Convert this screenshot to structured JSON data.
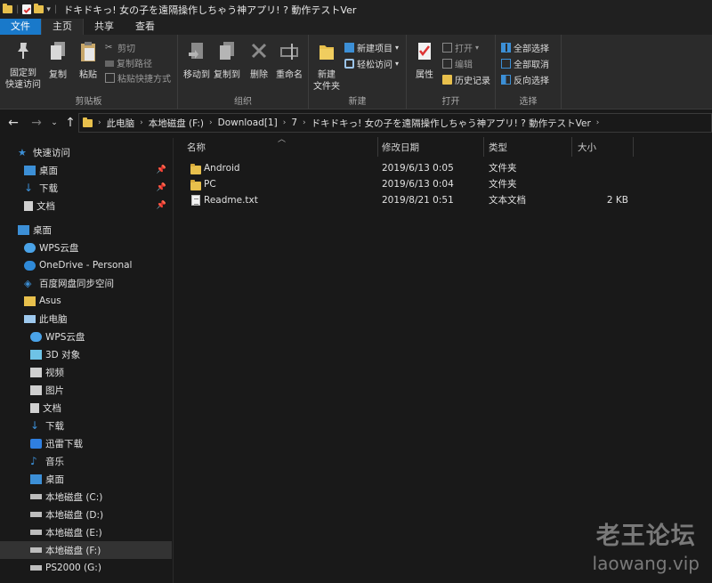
{
  "window": {
    "title": "ドキドキっ! 女の子を遠隔操作しちゃう神アプリ! ? 動作テストVer"
  },
  "ribbon_tabs": [
    "文件",
    "主页",
    "共享",
    "查看"
  ],
  "ribbon": {
    "clipboard": {
      "pin_label": "固定到\n快速访问",
      "copy": "复制",
      "paste": "粘贴",
      "cut": "剪切",
      "copy_path": "复制路径",
      "paste_shortcut": "粘贴快捷方式",
      "group": "剪贴板"
    },
    "organize": {
      "move_to": "移动到",
      "copy_to": "复制到",
      "delete": "删除",
      "rename": "重命名",
      "group": "组织"
    },
    "new": {
      "new_folder": "新建\n文件夹",
      "new_item": "新建项目",
      "easy_access": "轻松访问",
      "group": "新建"
    },
    "open": {
      "properties": "属性",
      "open": "打开",
      "edit": "编辑",
      "history": "历史记录",
      "group": "打开"
    },
    "select": {
      "select_all": "全部选择",
      "select_none": "全部取消",
      "invert": "反向选择",
      "group": "选择"
    }
  },
  "breadcrumb": [
    "此电脑",
    "本地磁盘 (F:)",
    "Download[1]",
    "7",
    "ドキドキっ! 女の子を遠隔操作しちゃう神アプリ! ? 動作テストVer"
  ],
  "nav": {
    "quick_access": "快速访问",
    "quick_items": [
      "桌面",
      "下载",
      "文档"
    ],
    "desktop": "桌面",
    "desktop_items": [
      "WPS云盘",
      "OneDrive - Personal",
      "百度网盘同步空间",
      "Asus",
      "此电脑"
    ],
    "pc_items": [
      "WPS云盘",
      "3D 对象",
      "视频",
      "图片",
      "文档",
      "下载",
      "迅雷下载",
      "音乐",
      "桌面",
      "本地磁盘 (C:)",
      "本地磁盘 (D:)",
      "本地磁盘 (E:)",
      "本地磁盘 (F:)",
      "PS2000 (G:)"
    ]
  },
  "columns": {
    "name": "名称",
    "modified": "修改日期",
    "type": "类型",
    "size": "大小"
  },
  "files": [
    {
      "name": "Android",
      "modified": "2019/6/13 0:05",
      "type": "文件夹",
      "size": "",
      "icon": "folder-icon"
    },
    {
      "name": "PC",
      "modified": "2019/6/13 0:04",
      "type": "文件夹",
      "size": "",
      "icon": "folder-icon"
    },
    {
      "name": "Readme.txt",
      "modified": "2019/8/21 0:51",
      "type": "文本文档",
      "size": "2 KB",
      "icon": "text-file-icon"
    }
  ],
  "watermark": {
    "line1": "老王论坛",
    "line2": "laowang.vip"
  }
}
